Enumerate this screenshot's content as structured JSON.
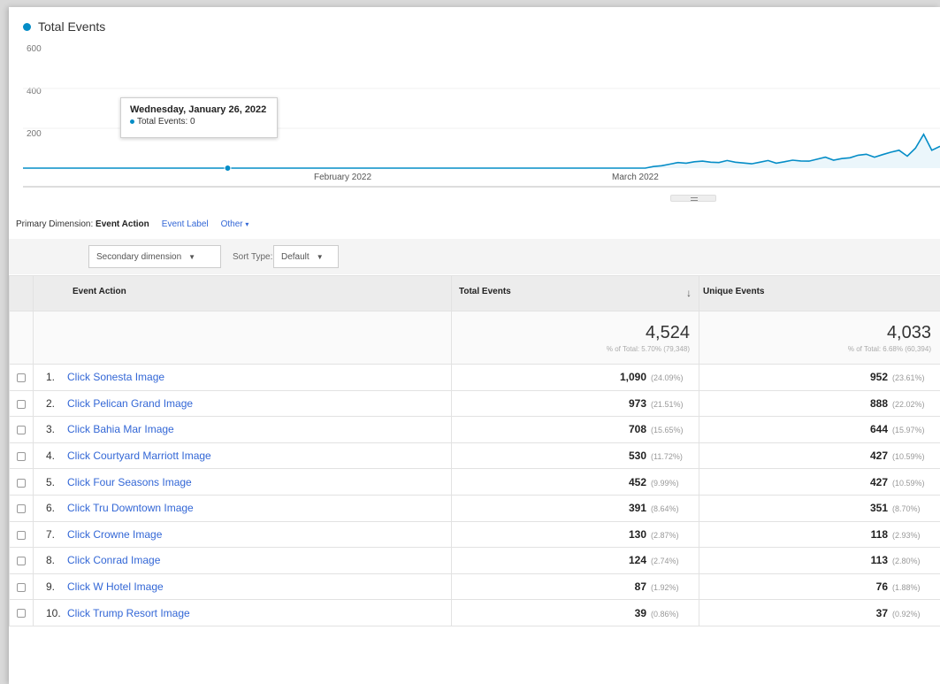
{
  "chart": {
    "legend": "Total Events",
    "y_ticks": [
      "600",
      "400",
      "200"
    ],
    "x_labels": [
      "February 2022",
      "March 2022"
    ],
    "tooltip": {
      "date": "Wednesday, January 26, 2022",
      "series_label": "Total Events: 0"
    }
  },
  "chart_data": {
    "type": "line",
    "series": [
      {
        "name": "Total Events",
        "values": [
          0,
          0,
          0,
          0,
          0,
          0,
          0,
          0,
          0,
          0,
          0,
          0,
          0,
          0,
          0,
          0,
          0,
          0,
          0,
          0,
          0,
          0,
          0,
          0,
          0,
          0,
          0,
          0,
          0,
          0,
          0,
          0,
          0,
          0,
          0,
          0,
          0,
          0,
          0,
          0,
          0,
          0,
          0,
          0,
          0,
          0,
          0,
          0,
          0,
          0,
          0,
          0,
          0,
          0,
          0,
          0,
          0,
          0,
          0,
          0,
          0,
          0,
          0,
          0,
          0,
          0,
          0,
          0,
          0,
          0,
          0,
          0,
          0,
          0,
          0,
          0,
          0,
          8,
          12,
          20,
          28,
          25,
          32,
          35,
          30,
          28,
          38,
          30,
          26,
          22,
          30,
          38,
          25,
          32,
          40,
          36,
          35,
          45,
          55,
          40,
          48,
          52,
          65,
          70,
          55,
          68,
          80,
          90,
          60,
          100,
          170,
          90,
          110
        ]
      }
    ],
    "ylim": [
      0,
      600
    ],
    "color": "#058dc7"
  },
  "dimension": {
    "label": "Primary Dimension:",
    "active": "Event Action",
    "links": [
      "Event Label",
      "Other"
    ]
  },
  "controls": {
    "secondary": "Secondary dimension",
    "sort_label": "Sort Type:",
    "sort_value": "Default"
  },
  "table": {
    "headers": {
      "event": "Event Action",
      "total": "Total Events",
      "unique": "Unique Events"
    },
    "totals": {
      "total": "4,524",
      "total_sub": "% of Total: 5.70% (79,348)",
      "unique": "4,033",
      "unique_sub": "% of Total: 6.68% (60,394)"
    },
    "rows": [
      {
        "rank": "1.",
        "event": "Click Sonesta Image",
        "total": "1,090",
        "total_pct": "(24.09%)",
        "unique": "952",
        "unique_pct": "(23.61%)"
      },
      {
        "rank": "2.",
        "event": "Click Pelican Grand Image",
        "total": "973",
        "total_pct": "(21.51%)",
        "unique": "888",
        "unique_pct": "(22.02%)"
      },
      {
        "rank": "3.",
        "event": "Click Bahia Mar Image",
        "total": "708",
        "total_pct": "(15.65%)",
        "unique": "644",
        "unique_pct": "(15.97%)"
      },
      {
        "rank": "4.",
        "event": "Click Courtyard Marriott Image",
        "total": "530",
        "total_pct": "(11.72%)",
        "unique": "427",
        "unique_pct": "(10.59%)"
      },
      {
        "rank": "5.",
        "event": "Click Four Seasons Image",
        "total": "452",
        "total_pct": "(9.99%)",
        "unique": "427",
        "unique_pct": "(10.59%)"
      },
      {
        "rank": "6.",
        "event": "Click Tru Downtown Image",
        "total": "391",
        "total_pct": "(8.64%)",
        "unique": "351",
        "unique_pct": "(8.70%)"
      },
      {
        "rank": "7.",
        "event": "Click Crowne Image",
        "total": "130",
        "total_pct": "(2.87%)",
        "unique": "118",
        "unique_pct": "(2.93%)"
      },
      {
        "rank": "8.",
        "event": "Click Conrad Image",
        "total": "124",
        "total_pct": "(2.74%)",
        "unique": "113",
        "unique_pct": "(2.80%)"
      },
      {
        "rank": "9.",
        "event": "Click W Hotel Image",
        "total": "87",
        "total_pct": "(1.92%)",
        "unique": "76",
        "unique_pct": "(1.88%)"
      },
      {
        "rank": "10.",
        "event": "Click Trump Resort Image",
        "total": "39",
        "total_pct": "(0.86%)",
        "unique": "37",
        "unique_pct": "(0.92%)"
      }
    ]
  }
}
